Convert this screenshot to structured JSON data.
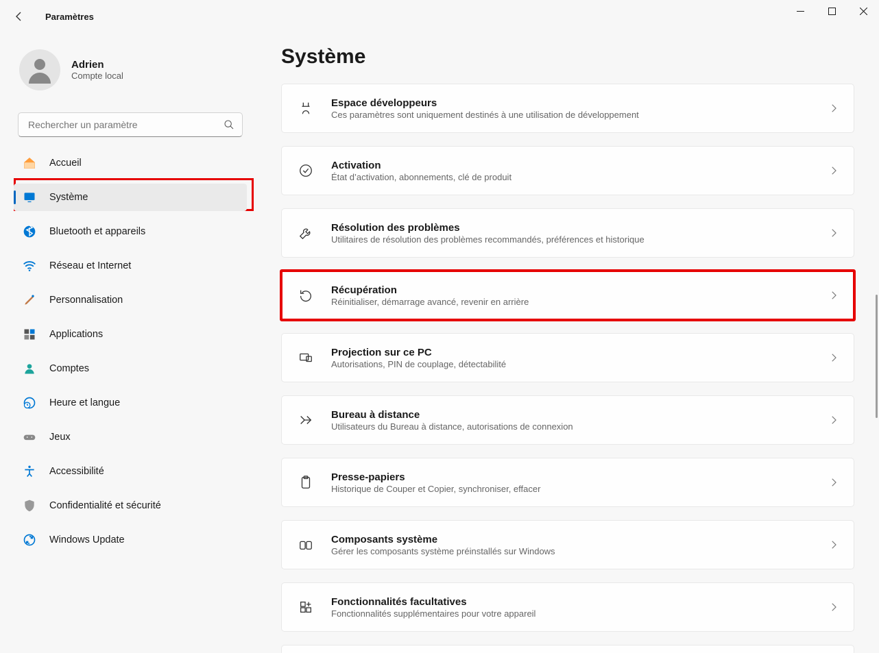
{
  "window": {
    "title": "Paramètres"
  },
  "profile": {
    "name": "Adrien",
    "subtitle": "Compte local"
  },
  "search": {
    "placeholder": "Rechercher un paramètre"
  },
  "sidebar": {
    "items": [
      {
        "label": "Accueil"
      },
      {
        "label": "Système"
      },
      {
        "label": "Bluetooth et appareils"
      },
      {
        "label": "Réseau et Internet"
      },
      {
        "label": "Personnalisation"
      },
      {
        "label": "Applications"
      },
      {
        "label": "Comptes"
      },
      {
        "label": "Heure et langue"
      },
      {
        "label": "Jeux"
      },
      {
        "label": "Accessibilité"
      },
      {
        "label": "Confidentialité et sécurité"
      },
      {
        "label": "Windows Update"
      }
    ]
  },
  "page": {
    "title": "Système"
  },
  "cards": [
    {
      "title": "Espace développeurs",
      "subtitle": "Ces paramètres sont uniquement destinés à une utilisation de développement"
    },
    {
      "title": "Activation",
      "subtitle": "État d’activation, abonnements, clé de produit"
    },
    {
      "title": "Résolution des problèmes",
      "subtitle": "Utilitaires de résolution des problèmes recommandés, préférences et historique"
    },
    {
      "title": "Récupération",
      "subtitle": "Réinitialiser, démarrage avancé, revenir en arrière"
    },
    {
      "title": "Projection sur ce PC",
      "subtitle": "Autorisations, PIN de couplage, détectabilité"
    },
    {
      "title": "Bureau à distance",
      "subtitle": "Utilisateurs du Bureau à distance, autorisations de connexion"
    },
    {
      "title": "Presse-papiers",
      "subtitle": "Historique de Couper et Copier, synchroniser, effacer"
    },
    {
      "title": "Composants système",
      "subtitle": "Gérer les composants système préinstallés sur Windows"
    },
    {
      "title": "Fonctionnalités facultatives",
      "subtitle": "Fonctionnalités supplémentaires pour votre appareil"
    }
  ]
}
